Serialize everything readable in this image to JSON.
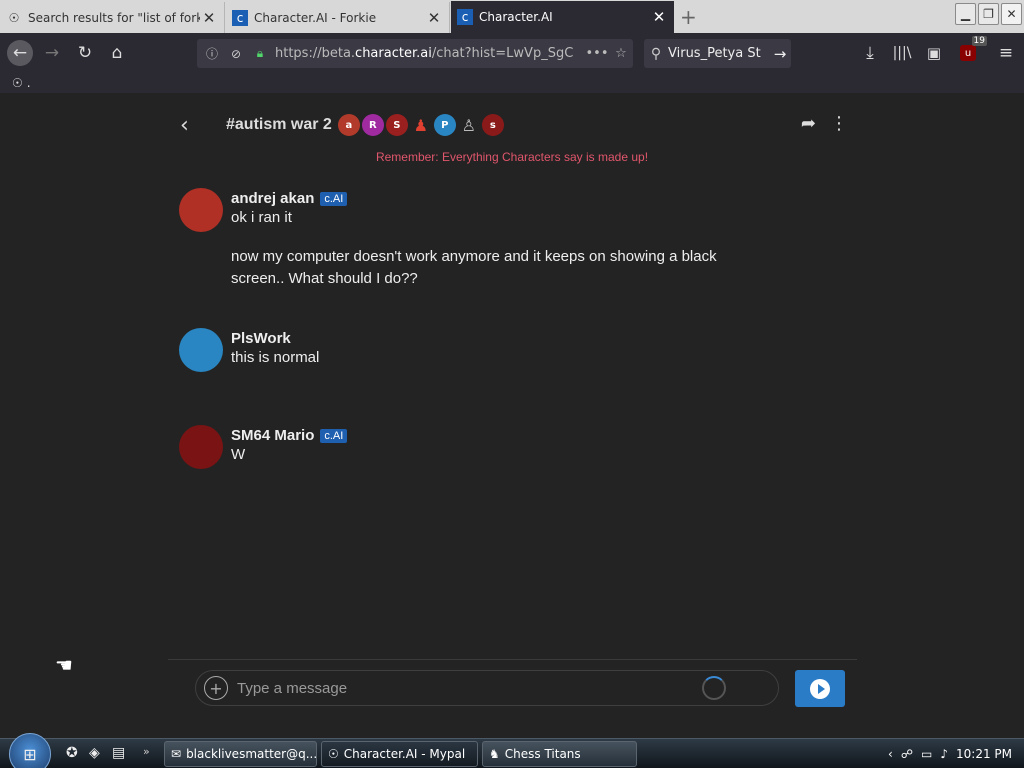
{
  "browser": {
    "tabs": [
      {
        "title": "Search results for \"list of forkie",
        "favicon": "mypal-icon",
        "active": false
      },
      {
        "title": "Character.AI - Forkie",
        "favicon": "character-ai-icon",
        "active": false
      },
      {
        "title": "Character.AI",
        "favicon": "character-ai-icon",
        "active": true
      }
    ],
    "url_prefix": "https://beta.",
    "url_domain": "character.ai",
    "url_suffix": "/chat?hist=LwVp_SgC",
    "search_text": "Virus_Petya St",
    "addon_badge": "19",
    "bookmark": "."
  },
  "chat": {
    "room_title": "#autism war 2",
    "participants": [
      {
        "letter": "a",
        "color": "#b23a2a"
      },
      {
        "letter": "R",
        "color": "#a02aa0"
      },
      {
        "letter": "S",
        "color": "#9a1f1f"
      },
      {
        "letter": "♟",
        "color": "#c0392b"
      },
      {
        "letter": "P",
        "color": "#2a86c2"
      },
      {
        "letter": "♙",
        "color": "#444444"
      },
      {
        "letter": "s",
        "color": "#8a1a1a"
      }
    ],
    "disclaimer": "Remember: Everything Characters say is made up!",
    "messages": [
      {
        "author": "andrej akan",
        "badge": "c.AI",
        "lines": [
          "ok i ran it",
          "now my computer doesn't work anymore and it keeps on showing a black screen.. What should I do??"
        ],
        "avatar_color": "#b03026"
      },
      {
        "author": "PlsWork",
        "badge": "",
        "lines": [
          "this is normal"
        ],
        "avatar_color": "#2a86c2"
      },
      {
        "author": "SM64 Mario",
        "badge": "c.AI",
        "lines": [
          "W"
        ],
        "avatar_color": "#7a1414"
      }
    ],
    "composer_placeholder": "Type a message"
  },
  "taskbar": {
    "items": [
      {
        "label": "blacklivesmatter@q...",
        "icon": "mail-icon"
      },
      {
        "label": "Character.AI - Mypal",
        "icon": "mypal-icon"
      },
      {
        "label": "Chess Titans",
        "icon": "chess-icon"
      }
    ],
    "clock": "10:21 PM"
  }
}
